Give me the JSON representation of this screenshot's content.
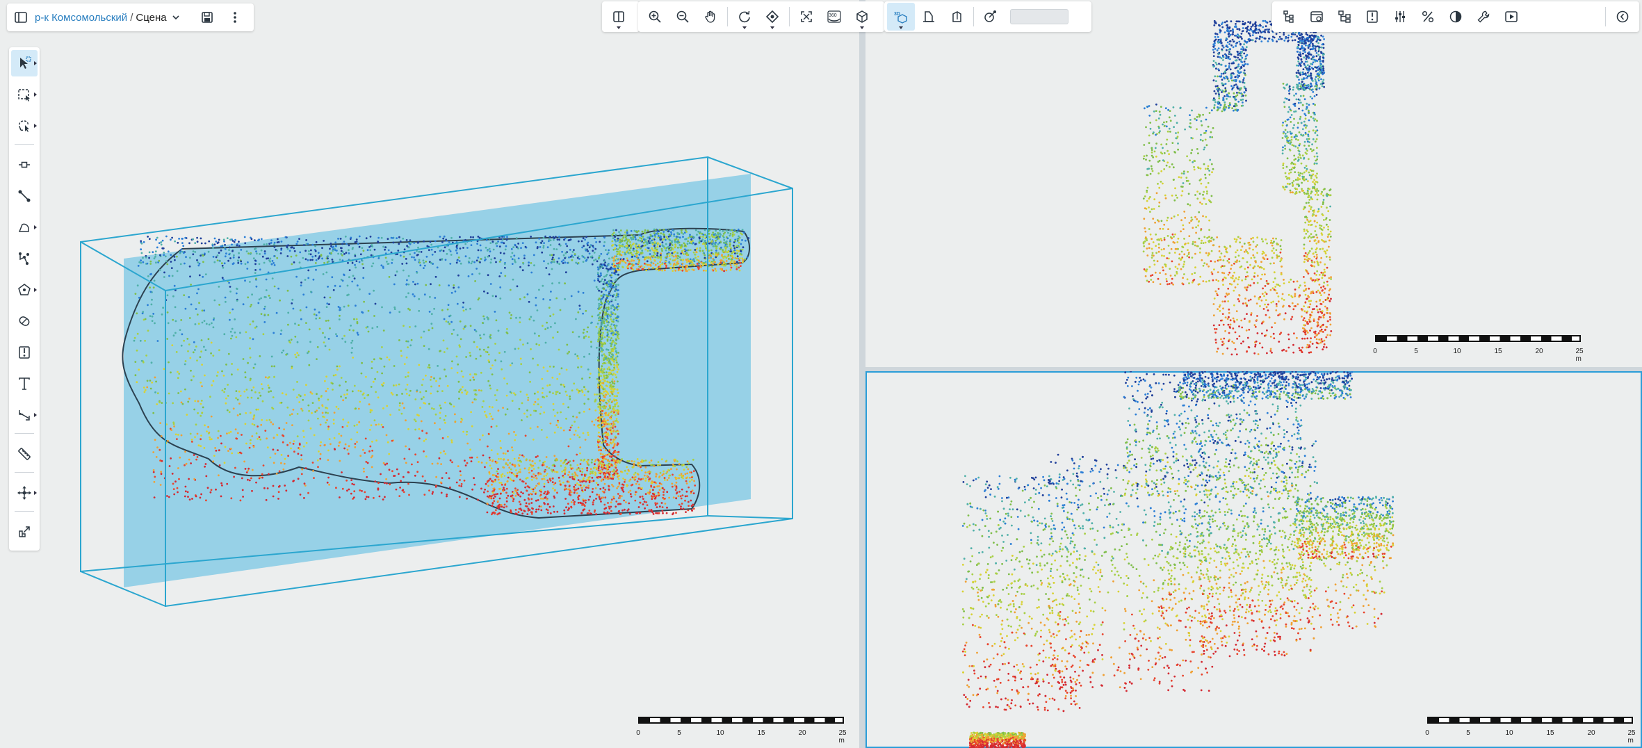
{
  "breadcrumb": {
    "project": "р-к Комсомольский",
    "separator": "/",
    "scene": "Сцена"
  },
  "icons": {
    "left_toolbar": [
      "panel-toggle-icon",
      "save-icon",
      "more-vertical-icon"
    ],
    "center_toolbar": [
      "split-view-icon",
      "zoom-in-icon",
      "zoom-out-icon",
      "pan-hand-icon",
      "orbit-icon",
      "focus-icon",
      "fit-extent-icon",
      "view-360-icon",
      "view-cube-icon"
    ],
    "mode_toolbar": [
      "3d-mode-icon",
      "section-icon",
      "extrude-icon",
      "measure-icon"
    ],
    "right_toolbar": [
      "tree-icon",
      "layers-icon",
      "hierarchy-icon",
      "split-section-icon",
      "filters-icon",
      "percent-icon",
      "contrast-icon",
      "wrench-icon",
      "play-icon",
      "history-icon"
    ],
    "side_tools": [
      "select-icon",
      "rect-select-icon",
      "lasso-select-icon",
      "point-icon",
      "line-icon",
      "polygon-icon",
      "polyline-icon",
      "pentagon-icon",
      "eraser-icon",
      "section-plane-icon",
      "text-icon",
      "dimension-icon",
      "ruler-icon",
      "move-icon",
      "export-icon"
    ]
  },
  "scale_bar": {
    "ticks": [
      "0",
      "5",
      "10",
      "15",
      "20",
      "25 m"
    ]
  },
  "colors": {
    "accent": "#2a9dd8",
    "box_fill": "#92cfe6",
    "box_stroke": "#2ba6cf",
    "points": [
      "#1f3f9a",
      "#2b7ed6",
      "#4fb0a8",
      "#7fbe4a",
      "#a7cf45",
      "#d8d234",
      "#f0a033",
      "#e8452e",
      "#d42a32"
    ]
  }
}
